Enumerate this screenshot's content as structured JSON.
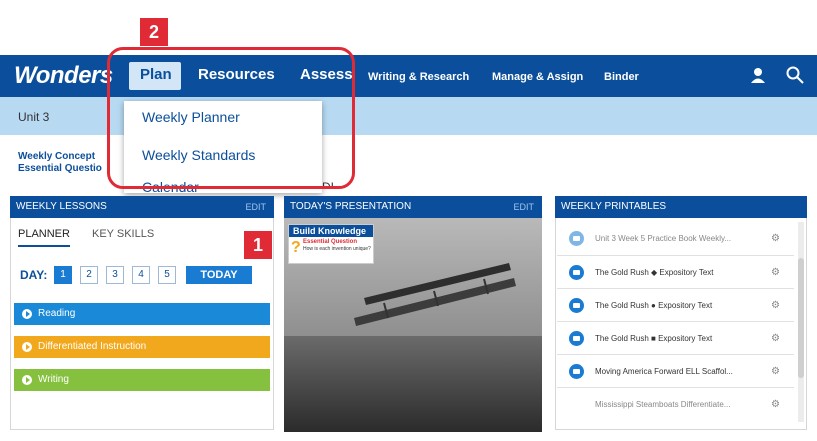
{
  "brand": {
    "logo": "Wonders"
  },
  "nav": {
    "plan": "Plan",
    "resources": "Resources",
    "assess": "Assess",
    "writing_research": "Writing & Research",
    "manage_assign": "Manage & Assign",
    "binder": "Binder"
  },
  "subbar": {
    "unit": "Unit 3"
  },
  "concept": {
    "line1": "Weekly Concept",
    "line2": "Essential Questio"
  },
  "dropdown": {
    "items": [
      "Weekly Planner",
      "Weekly Standards",
      "Calendar"
    ]
  },
  "callouts": {
    "one": "1",
    "two": "2"
  },
  "weekly_lessons": {
    "title": "WEEKLY LESSONS",
    "edit": "EDIT",
    "tabs": [
      "PLANNER",
      "KEY SKILLS"
    ],
    "day_label": "DAY:",
    "days": [
      "1",
      "2",
      "3",
      "4",
      "5"
    ],
    "today": "TODAY",
    "sections": [
      "Reading",
      "Differentiated Instruction",
      "Writing"
    ]
  },
  "presentation": {
    "title": "TODAY'S PRESENTATION",
    "edit": "EDIT",
    "card_title": "Build Knowledge",
    "card_subtitle": "Essential Question",
    "card_question": "How is each invention unique?"
  },
  "printables": {
    "title": "WEEKLY PRINTABLES",
    "items": [
      "Unit 3 Week 5 Practice Book Weekly...",
      "The Gold Rush ◆ Expository Text",
      "The Gold Rush ● Expository Text",
      "The Gold Rush ■ Expository Text",
      "Moving America Forward ELL Scaffol...",
      "Mississippi Steamboats Differentiate..."
    ]
  },
  "colors": {
    "primary": "#0b4f9c",
    "accent": "#1a7bd2",
    "callout": "#e02a35",
    "reading": "#1a8ad8",
    "differentiated": "#f2a81d",
    "writing": "#86c03f"
  }
}
